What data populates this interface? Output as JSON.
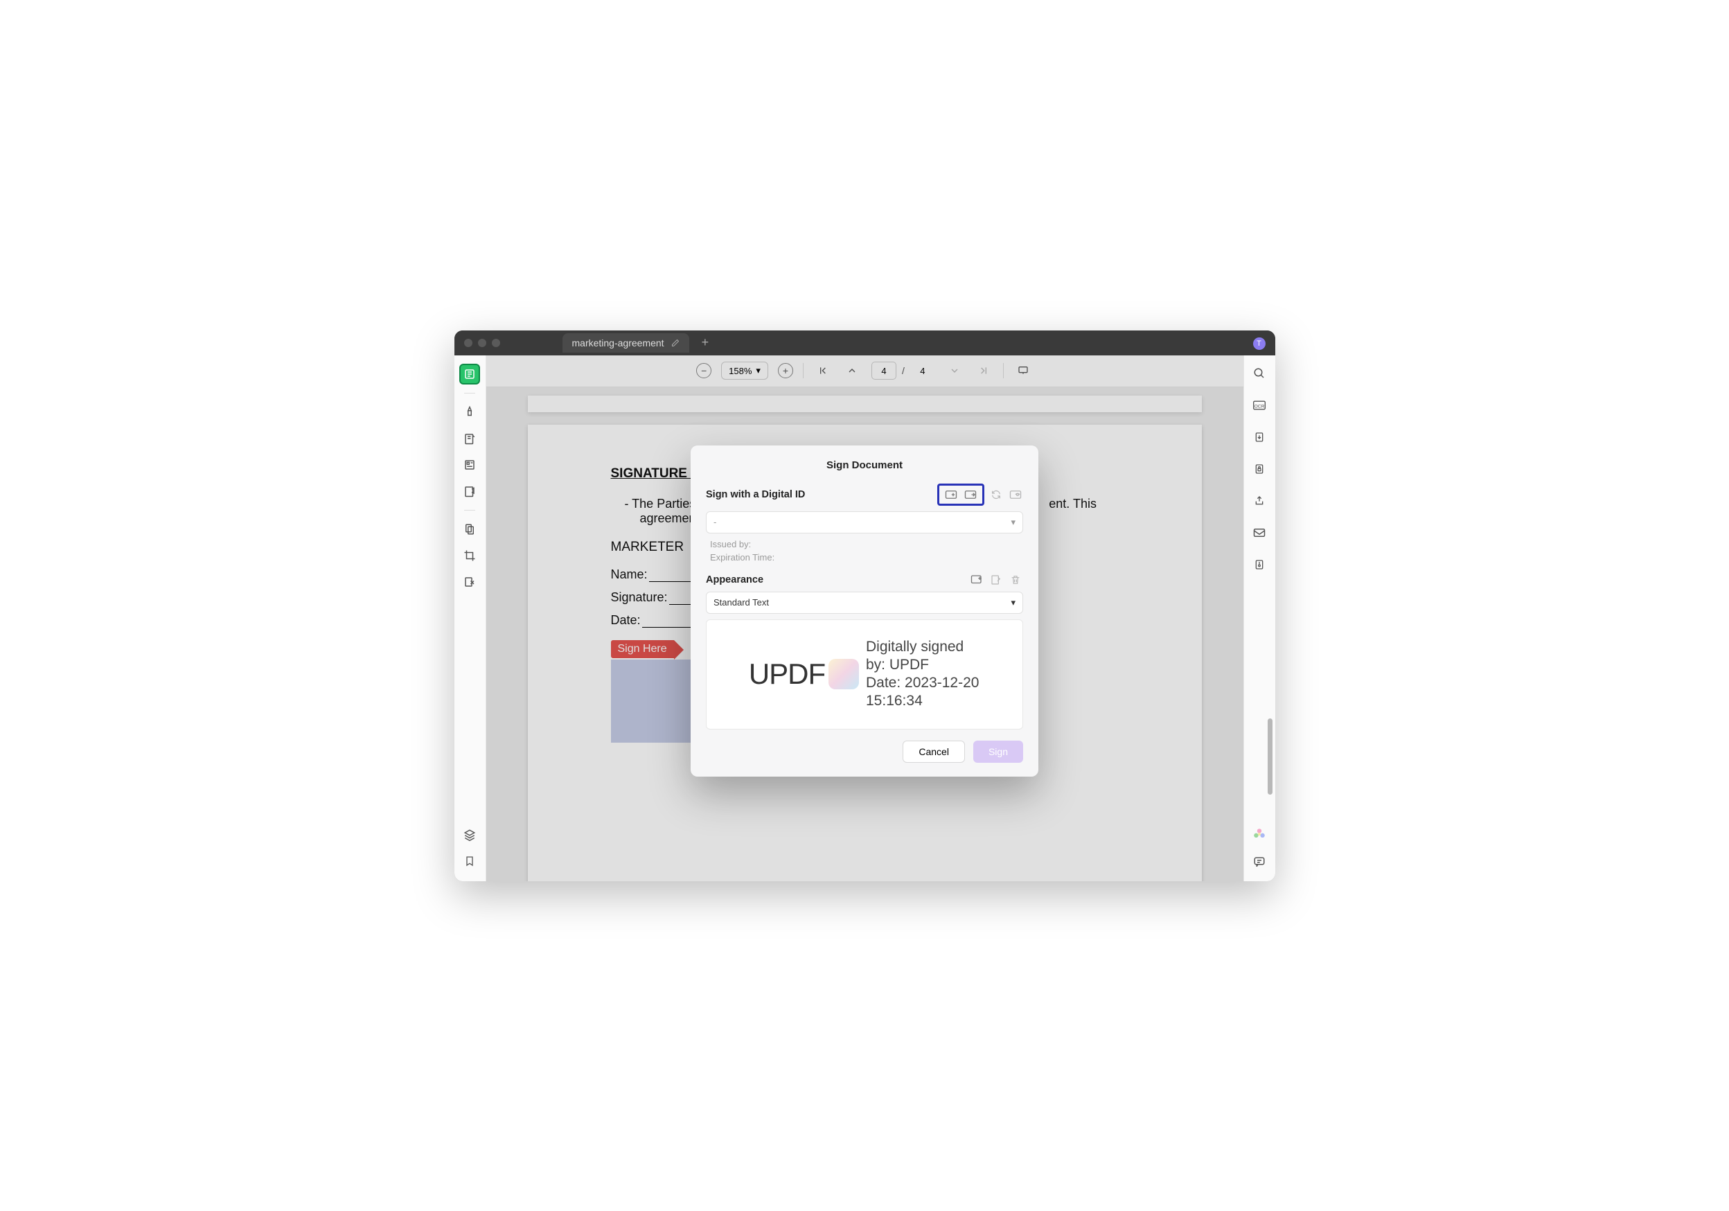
{
  "titlebar": {
    "tab_name": "marketing-agreement",
    "avatar_letter": "T"
  },
  "toolbar": {
    "zoom_value": "158%",
    "current_page": "4",
    "total_pages": "4",
    "page_sep": "/"
  },
  "document": {
    "section_title": "SIGNATURE A",
    "para_line1": "-    The Parties he",
    "para_line2_a": "ent. This",
    "para_line2_b": "agreement is",
    "role": "MARKETER",
    "field_name": "Name:",
    "field_sig": "Signature:",
    "field_date": "Date:",
    "sign_here": "Sign Here"
  },
  "dialog": {
    "title": "Sign Document",
    "sign_with_label": "Sign with a Digital ID",
    "id_selected": "-",
    "issued_by_label": "Issued by:",
    "expiration_label": "Expiration Time:",
    "appearance_label": "Appearance",
    "appearance_value": "Standard Text",
    "preview_name": "UPDF",
    "preview_text_l1": "Digitally signed",
    "preview_text_l2": "by: UPDF",
    "preview_text_l3": "Date: 2023-12-20",
    "preview_text_l4": "15:16:34",
    "cancel": "Cancel",
    "sign": "Sign"
  }
}
